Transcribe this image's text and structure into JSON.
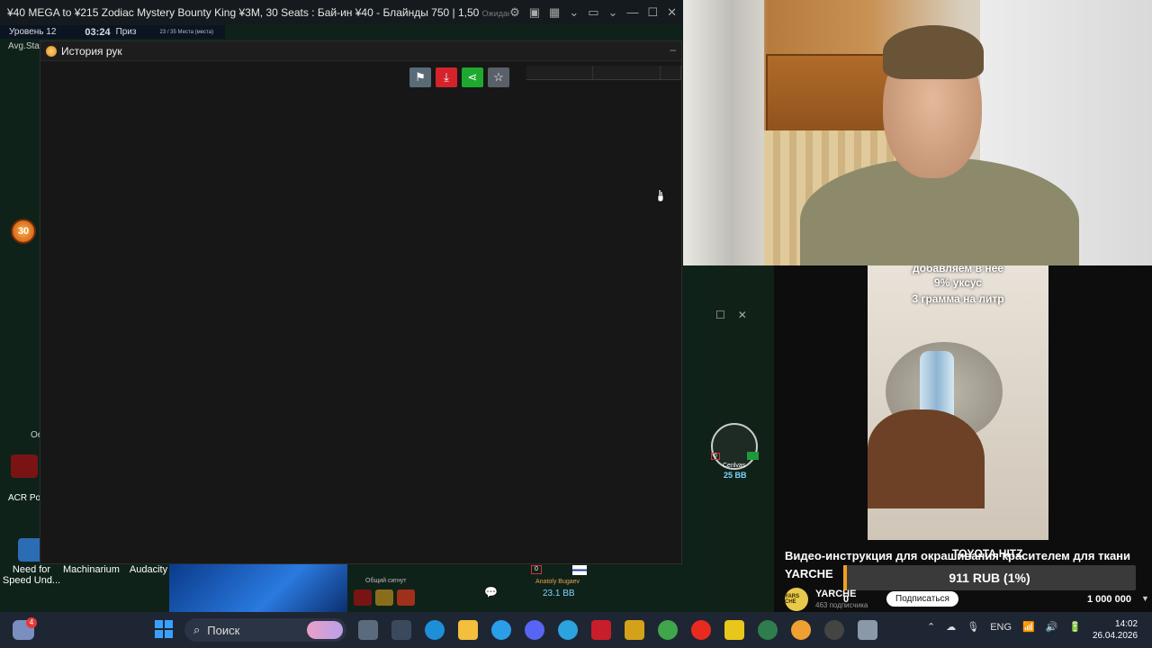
{
  "poker_window": {
    "title": "¥40 MEGA to ¥215 Zodiac Mystery Bounty King ¥3M, 30 Seats : Бай-ин ¥40 - Блайнды 750 | 1,50",
    "title_overflow": "Ожидание игры",
    "level": "Уровень 12",
    "clock": "03:24",
    "prize_label": "Приз",
    "seats_info": "23 / 35 Места (места)",
    "avg_stack_label": "Avg.Sta",
    "bubble_number": "30",
    "side_label_oe": "Ое",
    "side_label_acr": "ACR Pok",
    "pot_label": "Общий сигнут",
    "opponent_name": "Anatoly Bugaev",
    "opponent_stack": "23.1 BB",
    "opponent_badge": "0",
    "player_name": "Cenlvas",
    "player_stack": "25 BB",
    "player_badge": "0"
  },
  "hand_history": {
    "title": "История рук",
    "minimize": "–",
    "toolbar": [
      {
        "icon": "flag-icon",
        "color": "#5a6b78"
      },
      {
        "icon": "download-icon",
        "color": "#d4232b"
      },
      {
        "icon": "share-icon",
        "color": "#1fa82e"
      },
      {
        "icon": "star-icon",
        "color": "#5a6068"
      }
    ]
  },
  "desktop_icons": [
    {
      "label": "Need for Speed Und...",
      "color": "#2a6db5"
    },
    {
      "label": "Machinarium",
      "color": "#4a3b2a"
    },
    {
      "label": "Audacity",
      "color": "#f06a1e"
    }
  ],
  "video": {
    "caption_top1": "добавляем в нее",
    "caption_top2": "9% уксус",
    "caption_top3": "3 грамма на литр",
    "title_line1": "Видео-инструкция для окрашивания красителем для ткани",
    "title_line2": "YARCHE",
    "overlay_brand": "TOYOTA HITZ",
    "donation": "911 RUB (1%)",
    "goal_start": "0",
    "goal_target": "1 000 000",
    "channel_name": "YARCHE",
    "channel_avatar": "YARS CHE",
    "subscribers": "463 подписчика",
    "subscribe_label": "Подписаться"
  },
  "taskbar": {
    "search_placeholder": "Поиск",
    "notification_count": "4",
    "language": "ENG",
    "time": "14:02",
    "date": "26.04.2026",
    "apps": [
      {
        "name": "widgets",
        "color": "#7a8fbf"
      },
      {
        "name": "file-manager",
        "color": "#5b6b7d"
      },
      {
        "name": "vnc",
        "color": "#3a4a5c"
      },
      {
        "name": "edge",
        "color": "#1c8fd8"
      },
      {
        "name": "explorer",
        "color": "#f3bf3c"
      },
      {
        "name": "edge-blue",
        "color": "#2a9ee8"
      },
      {
        "name": "discord",
        "color": "#5865f2"
      },
      {
        "name": "telegram",
        "color": "#2aa3df"
      },
      {
        "name": "red-app",
        "color": "#c81e2a"
      },
      {
        "name": "winamp",
        "color": "#d4a11a"
      },
      {
        "name": "chrome",
        "color": "#3fa64a"
      },
      {
        "name": "yandex",
        "color": "#e82a1f"
      },
      {
        "name": "yellow-app",
        "color": "#e8c61a"
      },
      {
        "name": "poker-app",
        "color": "#2f7d4c"
      },
      {
        "name": "acr",
        "color": "#f0a030"
      },
      {
        "name": "obs",
        "color": "#444"
      },
      {
        "name": "settings",
        "color": "#8a98a8"
      }
    ]
  }
}
